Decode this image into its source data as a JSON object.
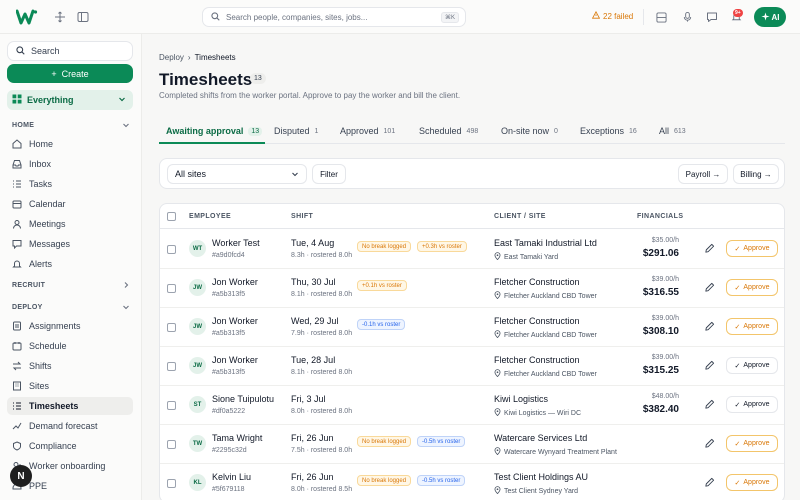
{
  "topbar": {
    "search_placeholder": "Search people, companies, sites, jobs...",
    "shortcut": "⌘K",
    "failed_label": "22 failed",
    "notif_badge": "9+",
    "ai_label": "AI"
  },
  "sidebar": {
    "search_label": "Search",
    "create_label": "Create",
    "workspace_label": "Everything",
    "sections": {
      "home": "HOME",
      "recruit": "RECRUIT",
      "deploy": "DEPLOY"
    },
    "home_items": [
      {
        "label": "Home",
        "icon": "home-icon"
      },
      {
        "label": "Inbox",
        "icon": "inbox-icon"
      },
      {
        "label": "Tasks",
        "icon": "tasks-icon"
      },
      {
        "label": "Calendar",
        "icon": "calendar-icon"
      },
      {
        "label": "Meetings",
        "icon": "meetings-icon"
      },
      {
        "label": "Messages",
        "icon": "messages-icon"
      },
      {
        "label": "Alerts",
        "icon": "alerts-icon"
      }
    ],
    "deploy_items": [
      {
        "label": "Assignments",
        "icon": "assignments-icon"
      },
      {
        "label": "Schedule",
        "icon": "schedule-icon"
      },
      {
        "label": "Shifts",
        "icon": "shifts-icon"
      },
      {
        "label": "Sites",
        "icon": "sites-icon"
      },
      {
        "label": "Timesheets",
        "icon": "timesheets-icon",
        "active": true
      },
      {
        "label": "Demand forecast",
        "icon": "demand-icon"
      },
      {
        "label": "Compliance",
        "icon": "compliance-icon"
      },
      {
        "label": "Worker onboarding",
        "icon": "onboarding-icon"
      },
      {
        "label": "PPE",
        "icon": "ppe-icon"
      }
    ],
    "avatar_letter": "N"
  },
  "breadcrumb": {
    "parent": "Deploy",
    "sep": "›",
    "current": "Timesheets"
  },
  "page": {
    "title": "Timesheets",
    "count": "13",
    "subtitle": "Completed shifts from the worker portal. Approve to pay the worker and bill the client."
  },
  "tabs": [
    {
      "label": "Awaiting approval",
      "count": "13"
    },
    {
      "label": "Disputed",
      "count": "1"
    },
    {
      "label": "Approved",
      "count": "101"
    },
    {
      "label": "Scheduled",
      "count": "498"
    },
    {
      "label": "On-site now",
      "count": "0"
    },
    {
      "label": "Exceptions",
      "count": "16"
    },
    {
      "label": "All",
      "count": "613"
    }
  ],
  "filters": {
    "site_select": "All sites",
    "filter_label": "Filter",
    "payroll_label": "Payroll →",
    "billing_label": "Billing →"
  },
  "table": {
    "headers": {
      "employee": "EMPLOYEE",
      "shift": "SHIFT",
      "client": "CLIENT / SITE",
      "financials": "FINANCIALS"
    },
    "approve_label": "Approve",
    "rows": [
      {
        "initials": "WT",
        "name": "Worker Test",
        "id": "#a9d0fcd4",
        "date": "Tue, 4 Aug",
        "hours": "8.3h · rostered 8.0h",
        "pills": [
          {
            "text": "No break logged",
            "kind": "warn"
          },
          {
            "text": "+0.3h vs roster",
            "kind": "warn"
          }
        ],
        "client": "East Tamaki Industrial Ltd",
        "site": "East Tamaki Yard",
        "rate": "$35.00/h",
        "total": "$291.06",
        "approve_style": "amber"
      },
      {
        "initials": "JW",
        "name": "Jon Worker",
        "id": "#a5b313f5",
        "date": "Thu, 30 Jul",
        "hours": "8.1h · rostered 8.0h",
        "pills": [
          {
            "text": "+0.1h vs roster",
            "kind": "warn"
          }
        ],
        "client": "Fletcher Construction",
        "site": "Fletcher Auckland CBD Tower",
        "rate": "$39.00/h",
        "total": "$316.55",
        "approve_style": "amber"
      },
      {
        "initials": "JW",
        "name": "Jon Worker",
        "id": "#a5b313f5",
        "date": "Wed, 29 Jul",
        "hours": "7.9h · rostered 8.0h",
        "pills": [
          {
            "text": "-0.1h vs roster",
            "kind": "info"
          }
        ],
        "client": "Fletcher Construction",
        "site": "Fletcher Auckland CBD Tower",
        "rate": "$39.00/h",
        "total": "$308.10",
        "approve_style": "amber"
      },
      {
        "initials": "JW",
        "name": "Jon Worker",
        "id": "#a5b313f5",
        "date": "Tue, 28 Jul",
        "hours": "8.1h · rostered 8.0h",
        "pills": [],
        "client": "Fletcher Construction",
        "site": "Fletcher Auckland CBD Tower",
        "rate": "$39.00/h",
        "total": "$315.25",
        "approve_style": "plain"
      },
      {
        "initials": "ST",
        "name": "Sione Tuipulotu",
        "id": "#df0a5222",
        "date": "Fri, 3 Jul",
        "hours": "8.0h · rostered 8.0h",
        "pills": [],
        "client": "Kiwi Logistics",
        "site": "Kiwi Logistics — Wiri DC",
        "rate": "$48.00/h",
        "total": "$382.40",
        "approve_style": "plain"
      },
      {
        "initials": "TW",
        "name": "Tama Wright",
        "id": "#2295c32d",
        "date": "Fri, 26 Jun",
        "hours": "7.5h · rostered 8.0h",
        "pills": [
          {
            "text": "No break logged",
            "kind": "warn"
          },
          {
            "text": "-0.5h vs roster",
            "kind": "info"
          }
        ],
        "client": "Watercare Services Ltd",
        "site": "Watercare Wynyard Treatment Plant",
        "rate": "",
        "total": "",
        "approve_style": "amber"
      },
      {
        "initials": "KL",
        "name": "Kelvin Liu",
        "id": "#5f679118",
        "date": "Fri, 26 Jun",
        "hours": "8.0h · rostered 8.5h",
        "pills": [
          {
            "text": "No break logged",
            "kind": "warn"
          },
          {
            "text": "-0.5h vs roster",
            "kind": "info"
          }
        ],
        "client": "Test Client Holdings AU",
        "site": "Test Client Sydney Yard",
        "rate": "",
        "total": "",
        "approve_style": "amber"
      }
    ]
  }
}
